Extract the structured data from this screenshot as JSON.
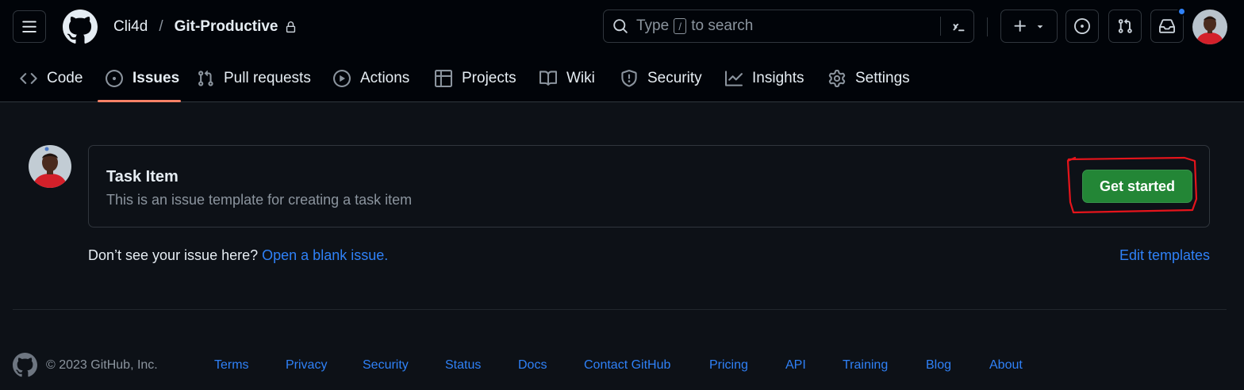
{
  "header": {
    "owner": "Cli4d",
    "separator": "/",
    "repo": "Git-Productive",
    "search": {
      "prefix": "Type",
      "key": "/",
      "suffix": "to search"
    }
  },
  "repo_nav": {
    "active": "Issues",
    "items": [
      {
        "label": "Code",
        "icon": "code-icon"
      },
      {
        "label": "Issues",
        "icon": "issue-opened-icon"
      },
      {
        "label": "Pull requests",
        "icon": "git-pull-request-icon"
      },
      {
        "label": "Actions",
        "icon": "play-icon"
      },
      {
        "label": "Projects",
        "icon": "table-icon"
      },
      {
        "label": "Wiki",
        "icon": "book-icon"
      },
      {
        "label": "Security",
        "icon": "shield-icon"
      },
      {
        "label": "Insights",
        "icon": "graph-icon"
      },
      {
        "label": "Settings",
        "icon": "gear-icon"
      }
    ]
  },
  "template": {
    "title": "Task Item",
    "description": "This is an issue template for creating a task item",
    "button": "Get started"
  },
  "blank_issue": {
    "prompt": "Don’t see your issue here?",
    "link": "Open a blank issue."
  },
  "edit_templates": "Edit templates",
  "footer": {
    "copyright": "© 2023 GitHub, Inc.",
    "links": [
      "Terms",
      "Privacy",
      "Security",
      "Status",
      "Docs",
      "Contact GitHub",
      "Pricing",
      "API",
      "Training",
      "Blog",
      "About"
    ]
  },
  "colors": {
    "background": "#0d1117",
    "header_background": "#010409",
    "accent_link": "#2f81f7",
    "primary_button": "#238636",
    "active_tab_underline": "#f78166",
    "annotation": "#e5141b",
    "notification_dot": "#2f81f7"
  }
}
